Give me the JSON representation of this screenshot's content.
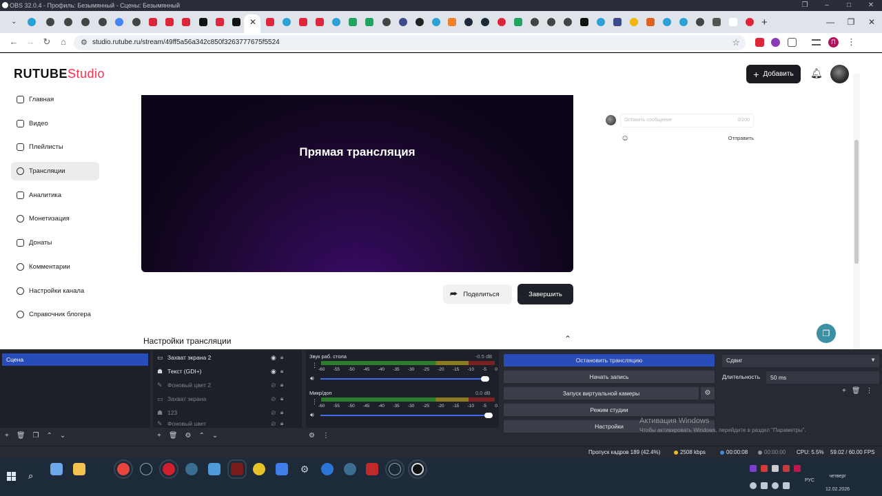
{
  "obs_window": {
    "title": "OBS 32.0.4 - Профиль: Безымянный - Сцены: Безымянный"
  },
  "browser": {
    "url": "studio.rutube.ru/stream/49ff5a56a342c850f3263777675f5524",
    "profile_letter": "П"
  },
  "header": {
    "logo_main": "RUTUBE",
    "logo_studio": "Studio",
    "add_button": "Добавить"
  },
  "sidebar": {
    "items": [
      {
        "label": "Главная",
        "active": false
      },
      {
        "label": "Видео",
        "active": false
      },
      {
        "label": "Плейлисты",
        "active": false
      },
      {
        "label": "Трансляции",
        "active": true
      },
      {
        "label": "Аналитика",
        "active": false
      },
      {
        "label": "Монетизация",
        "active": false
      },
      {
        "label": "Донаты",
        "active": false
      },
      {
        "label": "Комментарии",
        "active": false
      },
      {
        "label": "Настройки канала",
        "active": false
      },
      {
        "label": "Справочник блогера",
        "active": false
      }
    ]
  },
  "player": {
    "title": "Прямая трансляция",
    "share_button": "Поделиться",
    "finish_button": "Завершить"
  },
  "stream_settings": {
    "title": "Настройки трансляции"
  },
  "chat": {
    "placeholder": "Оставить сообщение",
    "counter": "0/200",
    "send": "Отправить"
  },
  "obs": {
    "scenes": [
      "Сцена"
    ],
    "sources": [
      {
        "label": "Захват экрана 2",
        "icon": "monitor-icon",
        "visible": true
      },
      {
        "label": "Текст (GDI+)",
        "icon": "text-icon",
        "visible": true
      },
      {
        "label": "Фоновый цвет 2",
        "icon": "brush-icon",
        "visible": false
      },
      {
        "label": "Захват экрана",
        "icon": "monitor-icon",
        "visible": false
      },
      {
        "label": "123",
        "icon": "image-icon",
        "visible": false
      },
      {
        "label": "Фоновый цвет",
        "icon": "brush-icon",
        "visible": false
      }
    ],
    "mixer": [
      {
        "label": "Звук раб. стола",
        "db": "-0.5 dB",
        "volume": 0.98
      },
      {
        "label": "Микр/доп",
        "db": "0.0 dB",
        "volume": 1.0
      }
    ],
    "meter_ticks": [
      "-60",
      "-55",
      "-50",
      "-45",
      "-40",
      "-35",
      "-30",
      "-25",
      "-20",
      "-15",
      "-10",
      "-5",
      "0"
    ],
    "controls": {
      "stop_stream": "Остановить трансляцию",
      "start_record": "Начать запись",
      "virtual_cam": "Запуск виртуальной камеры",
      "studio_mode": "Режим студии",
      "settings": "Настройки"
    },
    "transition": {
      "type": "Сдвиг",
      "duration_label": "Длительность",
      "duration_value": "50 ms"
    },
    "status": {
      "dropped": "Пропуск кадров 189 (42.4%)",
      "bitrate": "2508 kbps",
      "stream_time": "00:00:08",
      "rec_time": "00:00:00",
      "cpu": "CPU: 5.5%",
      "fps": "59.02 / 60.00 FPS"
    },
    "activation": {
      "line1": "Активация Windows",
      "line2": "Чтобы активировать Windows, перейдите в раздел \"Параметры\"."
    }
  },
  "taskbar": {
    "lang": "РУС",
    "day": "четверг",
    "date": "12.02.2026"
  },
  "colors": {
    "obs_accent": "#284cb8",
    "rutube_red": "#ff2d4b",
    "player_purple": "#3b0c6a"
  }
}
